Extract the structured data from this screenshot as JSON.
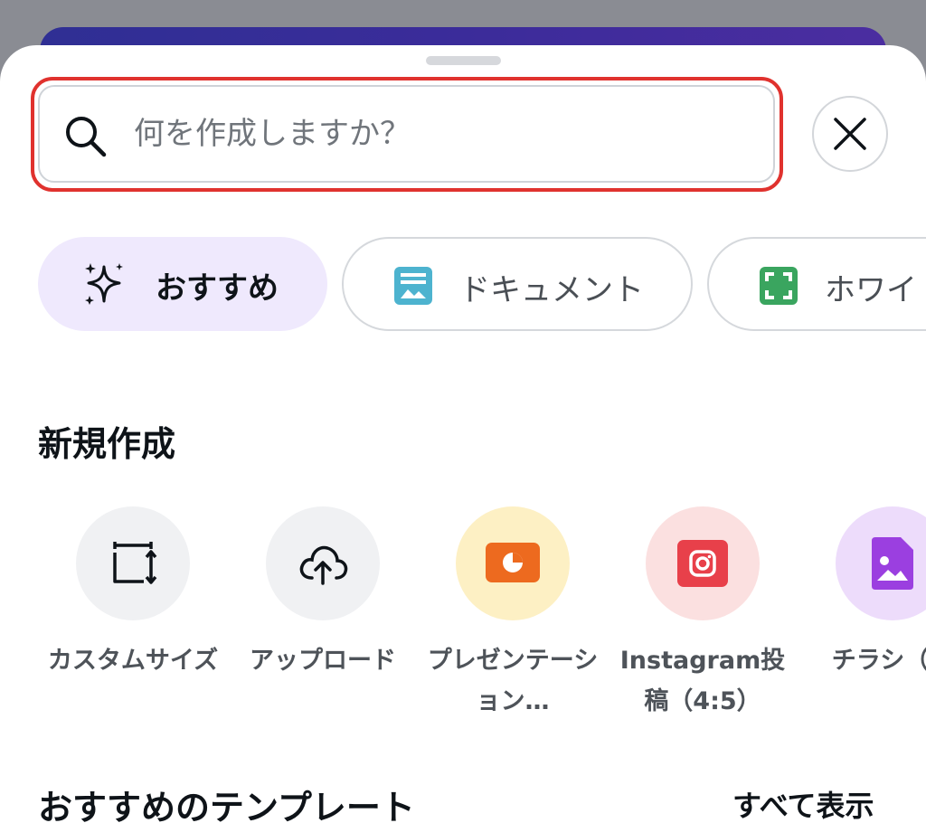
{
  "search": {
    "placeholder": "何を作成しますか？"
  },
  "chips": [
    {
      "label": "おすすめ",
      "icon": "sparkles-icon",
      "selected": true
    },
    {
      "label": "ドキュメント",
      "icon": "document-icon",
      "color": "#4db3cf"
    },
    {
      "label": "ホワイト",
      "icon": "whiteboard-icon",
      "color": "#3aa55f"
    }
  ],
  "create_section": {
    "title": "新規作成",
    "items": [
      {
        "label": "カスタムサイズ",
        "icon": "custom-size-icon",
        "bg": "#f0f1f3"
      },
      {
        "label": "アップロード",
        "icon": "upload-cloud-icon",
        "bg": "#f0f1f3"
      },
      {
        "label": "プレゼンテーション…",
        "icon": "presentation-icon",
        "bg": "#fdf0c4",
        "color": "#ed6a1f"
      },
      {
        "label": "Instagram投稿（4:5）",
        "icon": "instagram-icon",
        "bg": "#fbe0e0",
        "color": "#e8404a"
      },
      {
        "label": "チラシ（縦",
        "icon": "flyer-icon",
        "bg": "#eddcfb",
        "color": "#9b3fe0"
      }
    ]
  },
  "templates_section": {
    "title": "おすすめのテンプレート",
    "see_all": "すべて表示"
  }
}
